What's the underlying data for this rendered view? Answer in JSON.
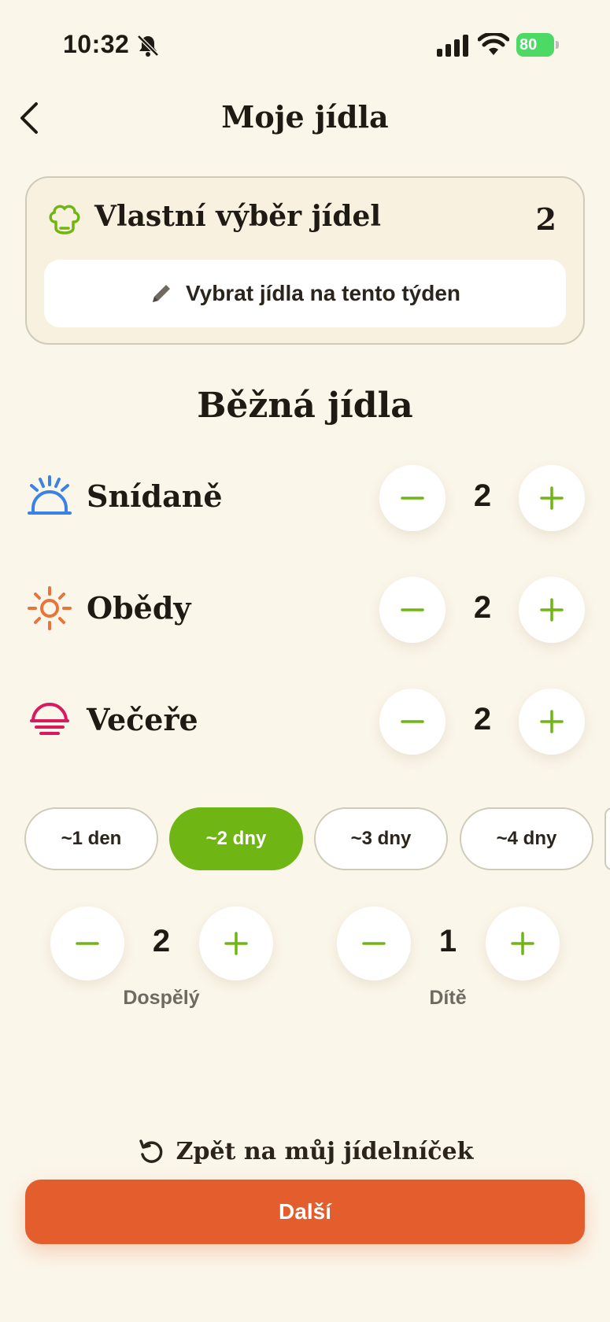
{
  "status_bar": {
    "time": "10:32",
    "battery": "80"
  },
  "header": {
    "title": "Moje jídla"
  },
  "custom_selection": {
    "title": "Vlastní výběr jídel",
    "count": "2",
    "button_label": "Vybrat jídla na tento týden"
  },
  "section_title": "Běžná jídla",
  "meals": [
    {
      "label": "Snídaně",
      "value": "2",
      "icon": "sunrise-icon",
      "color": "#3b82e6"
    },
    {
      "label": "Obědy",
      "value": "2",
      "icon": "sun-icon",
      "color": "#e8743b"
    },
    {
      "label": "Večeře",
      "value": "2",
      "icon": "sunset-icon",
      "color": "#d81b60"
    }
  ],
  "day_options": [
    "~1 den",
    "~2 dny",
    "~3 dny",
    "~4 dny"
  ],
  "selected_day": "~2 dny",
  "people": [
    {
      "label": "Dospělý",
      "value": "2"
    },
    {
      "label": "Dítě",
      "value": "1"
    }
  ],
  "back_to_menu": "Zpět na můj jídelníček",
  "next_button": "Další",
  "colors": {
    "accent_green": "#6fb514",
    "primary_orange": "#e45d2c",
    "background": "#fbf6ea"
  }
}
